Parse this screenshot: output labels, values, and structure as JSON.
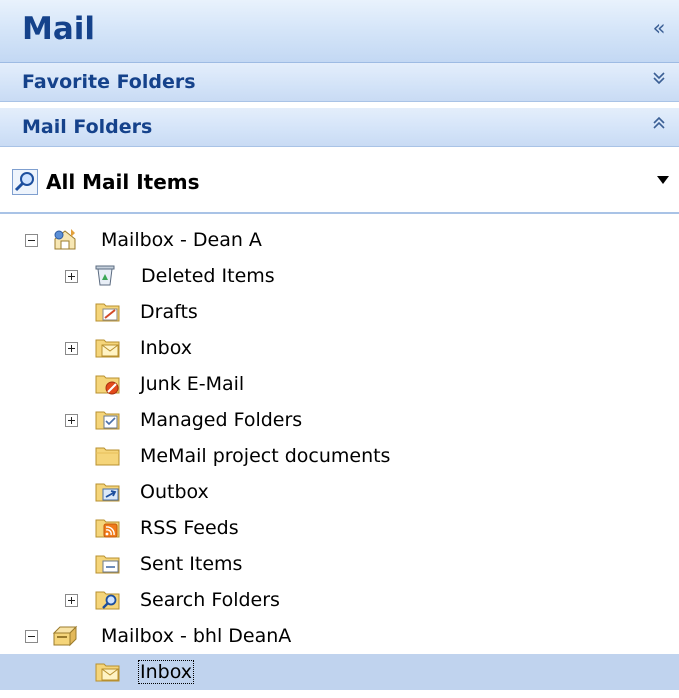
{
  "header": {
    "title": "Mail",
    "collapse_icon": "double-chevron-left-icon"
  },
  "sections": {
    "favorite_folders": {
      "label": "Favorite Folders",
      "icon": "double-chevron-down-icon"
    },
    "mail_folders": {
      "label": "Mail Folders",
      "icon": "double-chevron-up-icon"
    }
  },
  "view": {
    "label": "All Mail Items",
    "icon": "search-magnifier-icon",
    "dropdown_icon": "dropdown-arrow-icon"
  },
  "tree": [
    {
      "label": "Mailbox - Dean A",
      "icon": "mailbox-home-icon",
      "expander": "minus"
    },
    {
      "label": "Deleted Items",
      "icon": "recycle-bin-icon",
      "expander": "plus"
    },
    {
      "label": "Drafts",
      "icon": "drafts-folder-icon",
      "expander": "none"
    },
    {
      "label": "Inbox",
      "icon": "inbox-folder-icon",
      "expander": "plus"
    },
    {
      "label": "Junk E-Mail",
      "icon": "junk-folder-icon",
      "expander": "none"
    },
    {
      "label": "Managed Folders",
      "icon": "managed-folder-icon",
      "expander": "plus"
    },
    {
      "label": "MeMail project documents",
      "icon": "folder-icon",
      "expander": "none"
    },
    {
      "label": "Outbox",
      "icon": "outbox-folder-icon",
      "expander": "none"
    },
    {
      "label": "RSS Feeds",
      "icon": "rss-folder-icon",
      "expander": "none"
    },
    {
      "label": "Sent Items",
      "icon": "sent-folder-icon",
      "expander": "none"
    },
    {
      "label": "Search Folders",
      "icon": "search-folder-icon",
      "expander": "plus"
    },
    {
      "label": "Mailbox - bhl DeanA",
      "icon": "mailbox-icon",
      "expander": "minus"
    },
    {
      "label": "Inbox",
      "icon": "inbox-folder-icon",
      "expander": "none",
      "selected": true
    }
  ],
  "colors": {
    "header_text": "#15428b",
    "selection": "#c0d3ee",
    "separator": "#a9c3e6"
  }
}
